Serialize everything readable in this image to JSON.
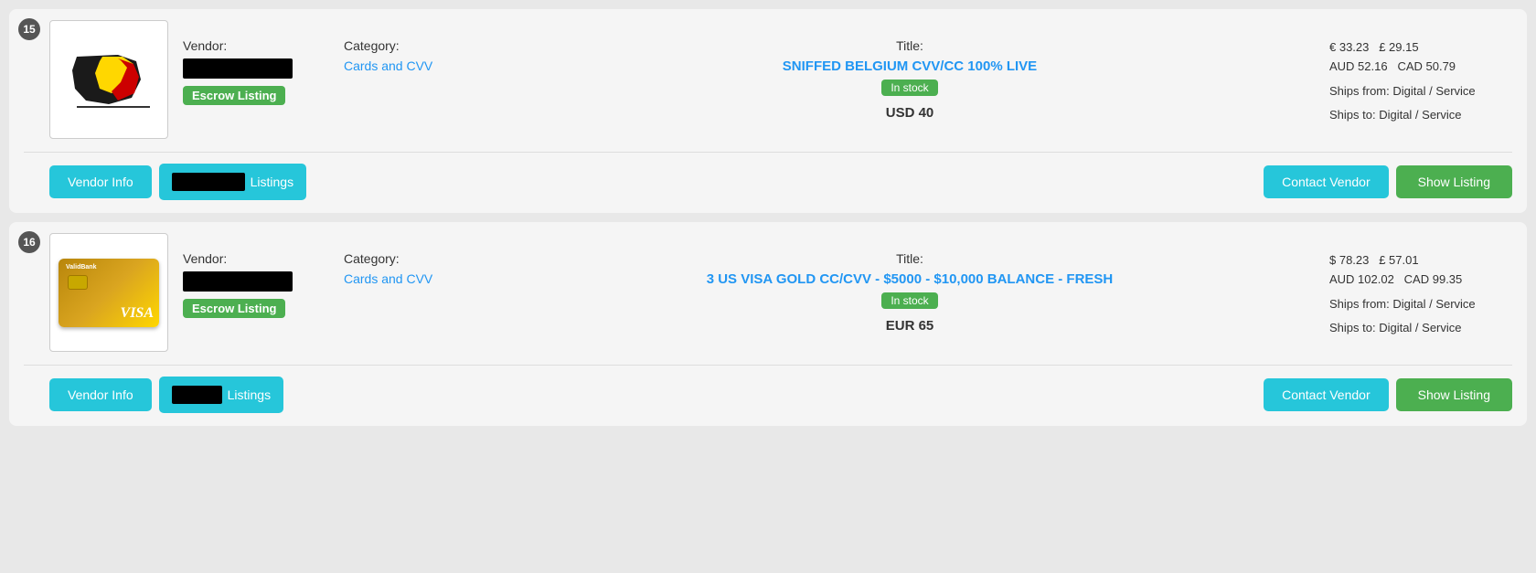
{
  "listings": [
    {
      "number": "15",
      "vendor_label": "Vendor:",
      "category_label": "Category:",
      "title_label": "Title:",
      "category": "Cards and CVV",
      "title": "SNIFFED BELGIUM CVV/CC 100% LIVE",
      "escrow_label": "Escrow Listing",
      "in_stock_label": "In stock",
      "price_usd": "USD 40",
      "price_eur": "€ 33.23",
      "price_gbp": "£ 29.15",
      "price_aud": "AUD 52.16",
      "price_cad": "CAD 50.79",
      "ships_from": "Ships from: Digital / Service",
      "ships_to": "Ships to: Digital / Service",
      "btn_vendor_info": "Vendor Info",
      "btn_listings": "Listings",
      "btn_contact": "Contact Vendor",
      "btn_show": "Show Listing",
      "image_type": "belgium_flag"
    },
    {
      "number": "16",
      "vendor_label": "Vendor:",
      "category_label": "Category:",
      "title_label": "Title:",
      "category": "Cards and CVV",
      "title": "3 US VISA GOLD CC/CVV - $5000 - $10,000 BALANCE - FRESH",
      "escrow_label": "Escrow Listing",
      "in_stock_label": "In stock",
      "price_usd": "EUR 65",
      "price_eur": "$ 78.23",
      "price_gbp": "£ 57.01",
      "price_aud": "AUD 102.02",
      "price_cad": "CAD 99.35",
      "ships_from": "Ships from: Digital / Service",
      "ships_to": "Ships to: Digital / Service",
      "btn_vendor_info": "Vendor Info",
      "btn_listings": "Listings",
      "btn_contact": "Contact Vendor",
      "btn_show": "Show Listing",
      "image_type": "visa_card"
    }
  ]
}
